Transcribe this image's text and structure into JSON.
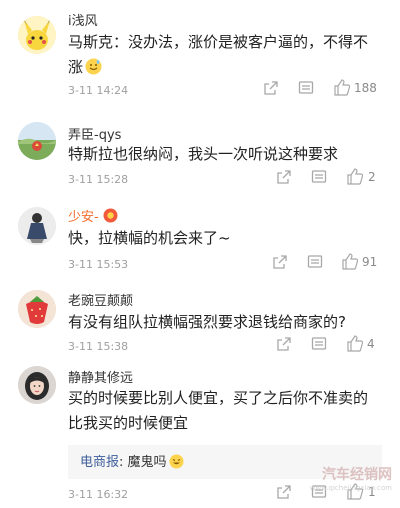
{
  "comments": [
    {
      "username": "i浅风",
      "text": "马斯克：没办法，涨价是被客户逼的，不得不涨",
      "time": "3-11 14:24",
      "likes": "188",
      "avatar_icon": "pikachu-avatar"
    },
    {
      "username": "弄臣-qys",
      "text": "特斯拉也很纳闷，我头一次听说这种要求",
      "time": "3-11 15:28",
      "likes": "2",
      "avatar_icon": "landscape-avatar"
    },
    {
      "username": "少安-",
      "text": "快，拉横幅的机会来了~",
      "time": "3-11 15:53",
      "likes": "91",
      "avatar_icon": "figure-avatar"
    },
    {
      "username": "老豌豆颠颠",
      "text": "有没有组队拉横幅强烈要求退钱给商家的?",
      "time": "3-11 15:38",
      "likes": "4",
      "avatar_icon": "strawberry-avatar"
    },
    {
      "username": "静静其修远",
      "text": "买的时候要比别人便宜，买了之后你不准卖的比我买的时候便宜",
      "time": "3-11 16:32",
      "likes": "1",
      "avatar_icon": "girl-avatar",
      "reply": {
        "user": "电商报",
        "text": "魔鬼吗"
      }
    }
  ],
  "colors": {
    "username_vip": "#f26d2b",
    "reply_user": "#3f5f9c"
  },
  "watermark": {
    "main": "汽车经销网",
    "url": "www.qichejingxiao.com"
  }
}
